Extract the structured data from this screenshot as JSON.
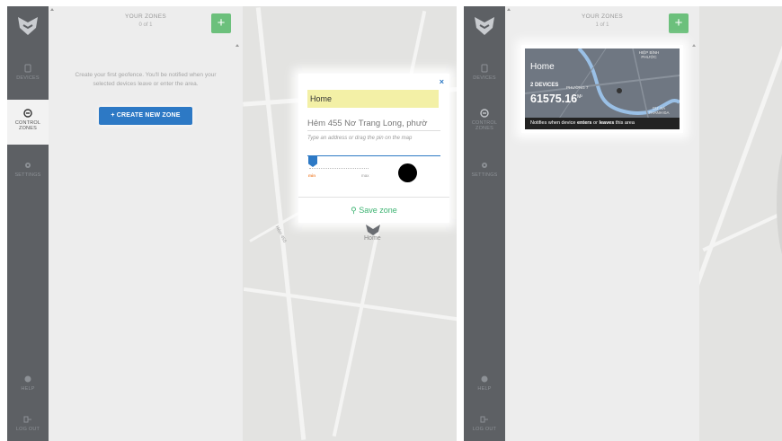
{
  "left_screen": {
    "sidebar": {
      "items": [
        {
          "label": "DEVICES",
          "icon": "device-icon"
        },
        {
          "label": "CONTROL",
          "label2": "ZONES",
          "icon": "zone-icon"
        },
        {
          "label": "SETTINGS",
          "icon": "gear-icon"
        },
        {
          "label": "HELP",
          "icon": "help-icon"
        },
        {
          "label": "LOG OUT",
          "icon": "logout-icon"
        }
      ]
    },
    "panel": {
      "title": "YOUR ZONES",
      "count": "0 of 1",
      "add_label": "+",
      "empty_message": "Create your first geofence. You'll be notified when your selected devices leave or enter the area.",
      "create_button": "+ CREATE NEW ZONE"
    },
    "zone_form": {
      "close": "×",
      "name_value": "Home",
      "address_value": "Hẻm 455 Nơ Trang Long, phườ",
      "hint": "Type an address or drag the pin on the map",
      "slider_min": "min",
      "slider_max": "max",
      "save_label": "Save zone"
    },
    "map": {
      "pin_label": "Home",
      "road_label": "Hẻm 455"
    }
  },
  "right_screen": {
    "sidebar": {
      "items": [
        {
          "label": "DEVICES"
        },
        {
          "label": "CONTROL",
          "label2": "ZONES"
        },
        {
          "label": "SETTINGS"
        },
        {
          "label": "HELP"
        },
        {
          "label": "LOG OUT"
        }
      ]
    },
    "panel": {
      "title": "YOUR ZONES",
      "count": "1 of 1",
      "add_label": "+"
    },
    "zone_card": {
      "name": "Home",
      "devices": "2 DEVICES",
      "area": "61575.16",
      "area_unit": "M²",
      "map_label_1": "HIỆP BÌNH PHƯỚC",
      "map_label_2": "PHƯỜNG 7",
      "map_label_3": "CƯ XÁ THANH ĐA",
      "footer_pre": "Notifies when device ",
      "footer_enters": "enters",
      "footer_mid": " or ",
      "footer_leaves": "leaves",
      "footer_post": " this area"
    }
  },
  "colors": {
    "sidebar": "#5d6064",
    "panel": "#ededed",
    "accent_green": "#6cc07c",
    "accent_blue": "#2d79c5",
    "map": "#e3e3e1"
  }
}
